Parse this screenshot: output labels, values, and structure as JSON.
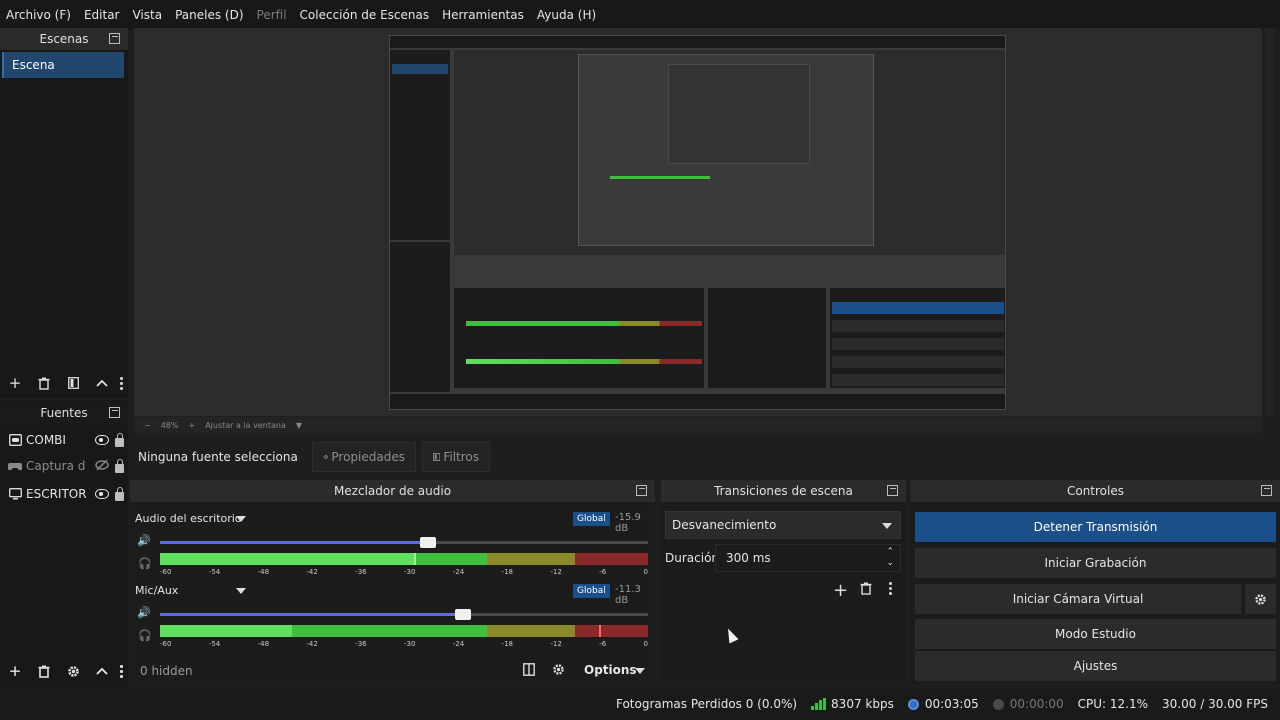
{
  "menu": [
    "Archivo (F)",
    "Editar",
    "Vista",
    "Paneles (D)",
    "Perfil",
    "Colección de Escenas",
    "Herramientas",
    "Ayuda (H)"
  ],
  "menu_disabled_index": 4,
  "scenes": {
    "title": "Escenas",
    "items": [
      "Escena"
    ]
  },
  "sources": {
    "title": "Fuentes",
    "items": [
      {
        "label": "COMBI",
        "icon": "gamepad-window-icon",
        "dim": false
      },
      {
        "label": "Captura d",
        "icon": "gamepad-icon",
        "dim": true
      },
      {
        "label": "ESCRITOR",
        "icon": "monitor-icon",
        "dim": false
      }
    ]
  },
  "zoom": {
    "level": "48%",
    "fit_label": "Ajustar a la ventana"
  },
  "context": {
    "no_source": "Ninguna fuente selecciona",
    "properties": "Propiedades",
    "filters": "Filtros"
  },
  "mixer": {
    "title": "Mezclador de audio",
    "channels": [
      {
        "name": "Audio del escritorio",
        "badge": "Global",
        "db": "-15.9 dB",
        "volume": 0.55,
        "meter_level": 0.52,
        "peak": 0.52
      },
      {
        "name": "Mic/Aux",
        "badge": "Global",
        "db": "-11.3 dB",
        "volume": 0.62,
        "meter_level": 0.27,
        "peak": 0.9
      }
    ],
    "ticks": [
      "-60",
      "-54",
      "-48",
      "-42",
      "-36",
      "-30",
      "-24",
      "-18",
      "-12",
      "-6",
      "0"
    ],
    "hidden_label": "0 hidden",
    "options_label": "Options"
  },
  "transitions": {
    "title": "Transiciones de escena",
    "selected": "Desvanecimiento",
    "duration_label": "Duración",
    "duration_value": "300 ms"
  },
  "controls": {
    "title": "Controles",
    "buttons": [
      "Detener Transmisión",
      "Iniciar Grabación",
      "Iniciar Cámara Virtual",
      "Modo Estudio",
      "Ajustes"
    ]
  },
  "status": {
    "dropped": "Fotogramas Perdidos 0 (0.0%)",
    "bitrate": "8307 kbps",
    "stream_time": "00:03:05",
    "rec_time": "00:00:00",
    "cpu": "CPU: 12.1%",
    "fps": "30.00 / 30.00 FPS"
  },
  "colors": {
    "accent": "#1b4f88",
    "meter_green": "#3fbf3f",
    "meter_yellow": "#8a8a2a",
    "meter_red": "#8a2a2a",
    "slider": "#5b6ee0"
  }
}
